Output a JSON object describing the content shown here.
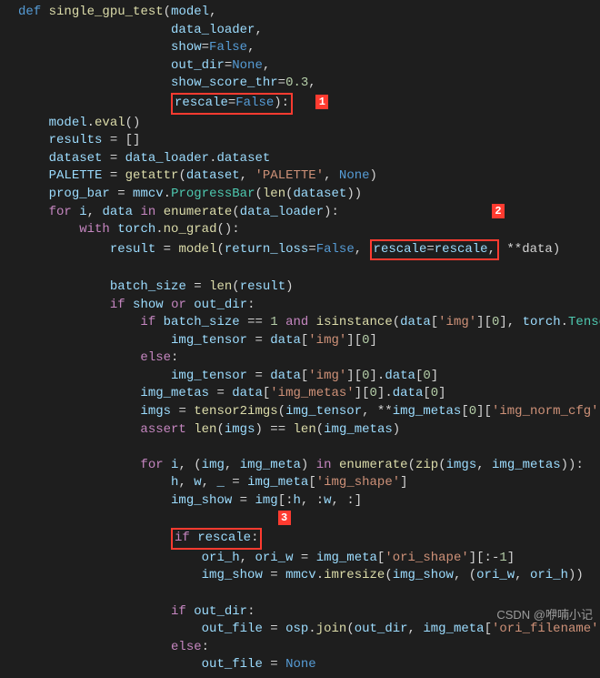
{
  "def": "def",
  "fn_name": "single_gpu_test",
  "params": {
    "model": "model",
    "data_loader": "data_loader",
    "show": "show",
    "show_def": "False",
    "out_dir": "out_dir",
    "out_dir_def": "None",
    "show_score_thr": "show_score_thr",
    "show_score_thr_def": "0.3",
    "rescale": "rescale",
    "rescale_def": "False"
  },
  "annot": {
    "one": "1",
    "two": "2",
    "three": "3"
  },
  "body": {
    "model_eval": "model.eval()",
    "results_eq": "results = []",
    "dataset_lhs": "dataset",
    "data_loader_dataset": "data_loader.dataset",
    "palette_lhs": "PALETTE",
    "getattr": "getattr",
    "palette_str": "'PALETTE'",
    "none": "None",
    "prog_bar_lhs": "prog_bar",
    "mmcv": "mmcv",
    "ProgressBar": "ProgressBar",
    "len": "len",
    "dataset": "dataset",
    "for_kw": "for",
    "in_kw": "in",
    "i": "i",
    "data": "data",
    "enumerate": "enumerate",
    "data_loader": "data_loader",
    "with_kw": "with",
    "torch": "torch",
    "no_grad": "no_grad",
    "result": "result",
    "model": "model",
    "return_loss": "return_loss",
    "false": "False",
    "rescale_kw": "rescale",
    "rescale_arg": "rescale",
    "stardata": "**data",
    "batch_size": "batch_size",
    "if_kw": "if",
    "or_kw": "or",
    "and_kw": "and",
    "show": "show",
    "out_dir": "out_dir",
    "eqeq": "==",
    "one": "1",
    "isinstance": "isinstance",
    "img_str": "'img'",
    "zero": "0",
    "Tensor": "Tensor",
    "img_tensor": "img_tensor",
    "else_kw": "else",
    "img_metas": "img_metas",
    "img_metas_str": "'img_metas'",
    "imgs": "imgs",
    "tensor2imgs": "tensor2imgs",
    "img_norm_cfg_str": "'img_norm_cfg'",
    "assert_kw": "assert",
    "img": "img",
    "img_meta": "img_meta",
    "zip": "zip",
    "h": "h",
    "w": "w",
    "us": "_",
    "img_shape_str": "'img_shape'",
    "img_show": "img_show",
    "ori_h": "ori_h",
    "ori_w": "ori_w",
    "ori_shape_str": "'ori_shape'",
    "imresize": "imresize",
    "out_file": "out_file",
    "osp": "osp",
    "join": "join",
    "ori_filename_str": "'ori_filename'"
  },
  "footer": "CSDN @咿喃小记"
}
